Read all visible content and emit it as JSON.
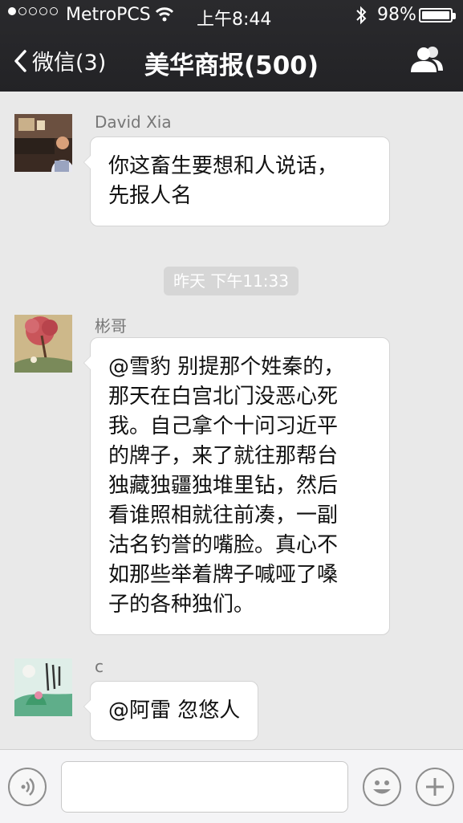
{
  "status_bar": {
    "carrier": "MetroPCS",
    "time": "上午8:44",
    "battery": "98%"
  },
  "nav": {
    "back_label": "微信(3)",
    "title": "美华商报(500)"
  },
  "messages": [
    {
      "sender": "David Xia",
      "lines": [
        "你这畜生要想和人说话，",
        "先报人名"
      ]
    },
    {
      "sender": "彬哥",
      "lines": [
        "@雪豹 别提那个姓秦的，",
        "那天在白宫北门没恶心死",
        "我。自己拿个十问习近平",
        "的牌子，来了就往那帮台",
        "独藏独疆独堆里钻，然后",
        "看谁照相就往前凑，一副",
        "沽名钓誉的嘴脸。真心不",
        "如那些举着牌子喊哑了嗓",
        "子的各种独们。"
      ]
    },
    {
      "sender": "c",
      "lines": [
        "@阿雷 忽悠人"
      ]
    }
  ],
  "timestamp": "昨天 下午11:33",
  "icons": {
    "back": "chevron-left-icon",
    "group_info": "people-icon",
    "voice": "voice-icon",
    "emoji": "emoji-icon",
    "more": "plus-icon"
  }
}
